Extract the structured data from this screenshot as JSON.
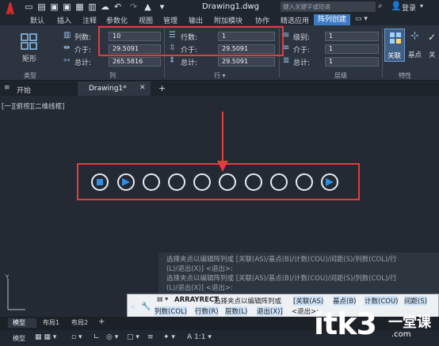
{
  "title": {
    "filename": "Drawing1.dwg",
    "search_placeholder": "键入关键字或短语",
    "login": "登录"
  },
  "menu": [
    "默认",
    "插入",
    "注释",
    "参数化",
    "视图",
    "管理",
    "输出",
    "附加模块",
    "协作",
    "精选应用",
    "阵列创建"
  ],
  "ribbon": {
    "type_button": "矩形",
    "type_panel": "类型",
    "columns_label": "列数:",
    "columns_value": "10",
    "col_between_label": "介于:",
    "col_between_value": "29.5091",
    "col_total_label": "总计:",
    "col_total_value": "265.5816",
    "column_panel": "列",
    "rows_label": "行数:",
    "rows_value": "1",
    "row_between_label": "介于:",
    "row_between_value": "29.5091",
    "row_total_label": "总计:",
    "row_total_value": "29.5091",
    "row_panel": "行",
    "levels_label": "级别:",
    "levels_value": "1",
    "level_between_label": "介于:",
    "level_between_value": "1",
    "level_total_label": "总计:",
    "level_total_value": "1",
    "level_panel": "层级",
    "assoc_button": "关联",
    "basepoint_button": "基点",
    "props_panel": "特性",
    "close_button": "关"
  },
  "tabs": {
    "start": "开始",
    "drawing": "Drawing1*"
  },
  "viewport_label": "[一][俯视][二维线框]",
  "command": {
    "history_1": "选择夹点以编辑阵列或 [关联(AS)/基点(B)/计数(COU)/间距(S)/列数(COL)/行",
    "history_1b": "(L)/退出(X)] <退出>:",
    "history_2": "选择夹点以编辑阵列或 [关联(AS)/基点(B)/计数(COU)/间距(S)/列数(COL)/行",
    "history_2b": "(L)/退出(X)] <退出>:",
    "prompt_cmd": "ARRAYRECT",
    "prompt_text": "选择夹点以编辑阵列或",
    "opt_assoc": "[关联(AS)",
    "opt_base": "基点(B)",
    "opt_count": "计数(COU)",
    "opt_spacing": "间距(S)",
    "opt_cols": "列数(COL)",
    "opt_rows": "行数(R)",
    "opt_levels": "层数(L)",
    "opt_exit": "退出(X)]",
    "opt_default": "<退出>:"
  },
  "layout_tabs": [
    "模型",
    "布局1",
    "布局2"
  ],
  "status": {
    "model": "模型"
  },
  "watermark": {
    "text": "itk3",
    "suffix": ".com",
    "cn": "一堂课"
  },
  "colors": {
    "highlight": "#e33d3d",
    "grip": "#2f8fe3",
    "accent_tab": "#3d7bc7"
  }
}
